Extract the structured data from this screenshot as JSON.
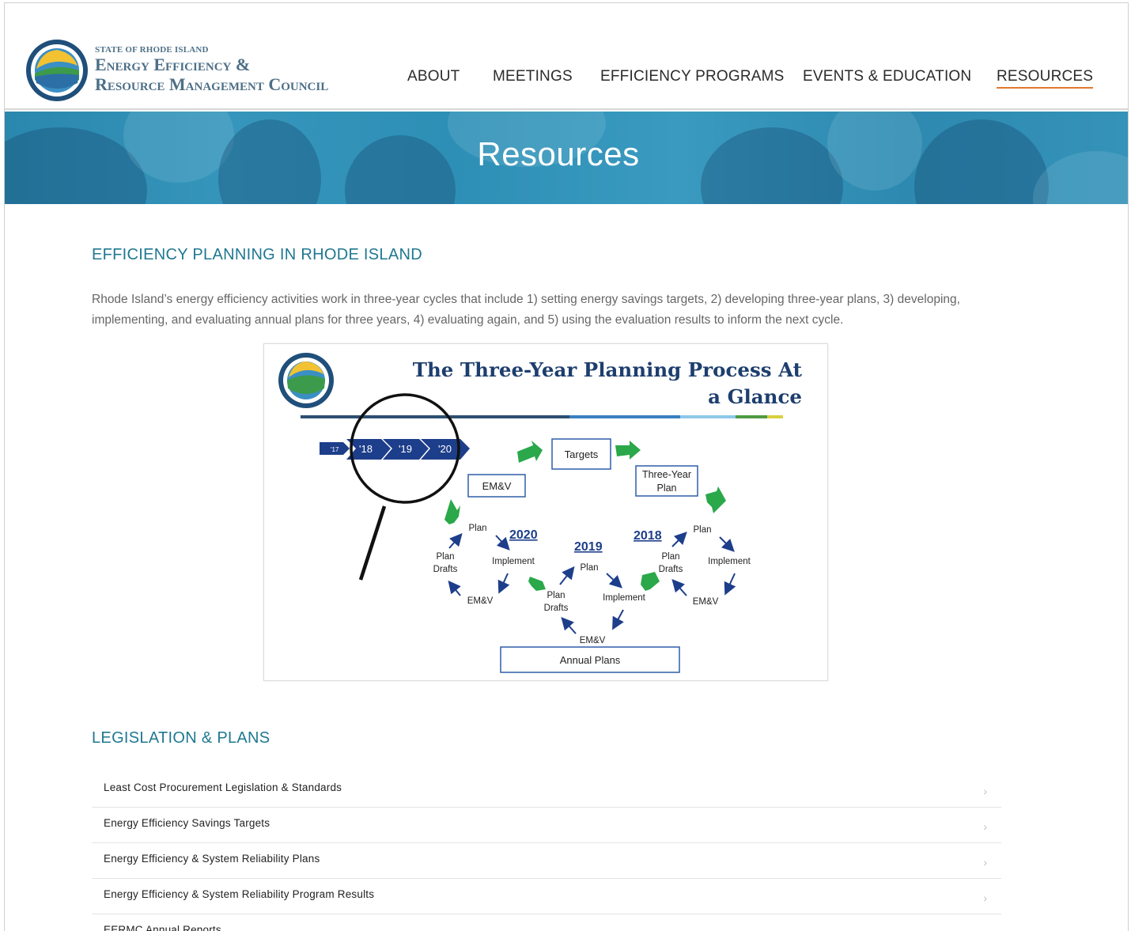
{
  "header": {
    "logo": {
      "small_line": "STATE OF RHODE ISLAND",
      "line1": "Energy Efficiency &",
      "line2": "Resource Management Council",
      "seal_text": "STATE OF RHODE ISLAND"
    },
    "nav": [
      {
        "label": "ABOUT",
        "active": false
      },
      {
        "label": "MEETINGS",
        "active": false
      },
      {
        "label": "EFFICIENCY PROGRAMS",
        "active": false
      },
      {
        "label": "EVENTS & EDUCATION",
        "active": false
      },
      {
        "label": "RESOURCES",
        "active": true
      }
    ],
    "active_underline_color": "#e07a2e"
  },
  "banner": {
    "title": "Resources",
    "color": "#2f8fb5"
  },
  "section1": {
    "title": "EFFICIENCY PLANNING IN RHODE ISLAND",
    "intro": "Rhode Island’s energy efficiency activities work in three-year cycles that include 1) setting energy savings targets, 2) developing three-year plans, 3) developing, implementing, and evaluating annual plans for three years, 4) evaluating again, and 5) using the evaluation results to inform the next cycle."
  },
  "diagram": {
    "title": "The Three-Year Planning Process At a Glance",
    "timeline": [
      "'17",
      "'18",
      "'19",
      "'20"
    ],
    "boxes": {
      "targets": "Targets",
      "emv": "EM&V",
      "three_year_plan_1": "Three-Year",
      "three_year_plan_2": "Plan",
      "annual_plans": "Annual Plans"
    },
    "years": [
      "2020",
      "2019",
      "2018"
    ],
    "cycle_labels": {
      "plan": "Plan",
      "implement": "Implement",
      "emv": "EM&V",
      "plan_drafts_1": "Plan",
      "plan_drafts_2": "Drafts"
    },
    "colors": {
      "navy": "#1d3e8a",
      "green": "#2aa84a",
      "box_border": "#2f5fa8"
    }
  },
  "section2": {
    "title": "LEGISLATION & PLANS",
    "items": [
      "Least Cost Procurement Legislation & Standards",
      "Energy Efficiency Savings Targets",
      "Energy Efficiency & System Reliability Plans",
      "Energy Efficiency & System Reliability Program Results",
      "EERMC Annual Reports"
    ],
    "chevron": "›"
  }
}
